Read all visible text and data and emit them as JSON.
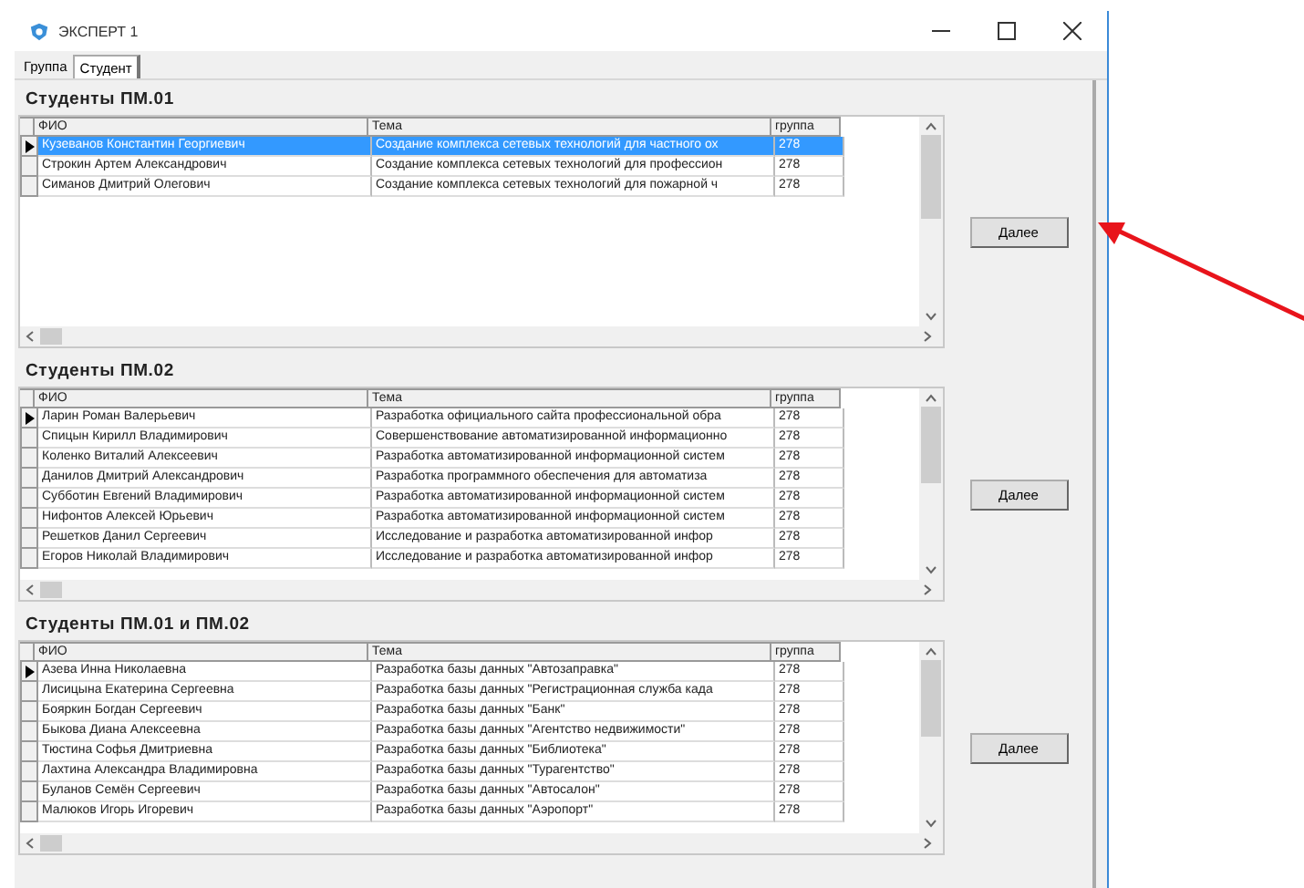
{
  "window": {
    "title": "ЭКСПЕРТ 1"
  },
  "tabs": [
    {
      "label": "Группа",
      "selected": false
    },
    {
      "label": "Студент",
      "selected": true
    }
  ],
  "sections": [
    {
      "title": "Студенты  ПМ.01",
      "button": "Далее",
      "columns": [
        "ФИО",
        "Тема",
        "группа"
      ],
      "rows": [
        {
          "cells": [
            "Кузеванов Константин Георгиевич",
            "Создание комплекса сетевых технологий для частного ох",
            "278"
          ],
          "current": true,
          "selected": true
        },
        {
          "cells": [
            "Строкин Артем Александрович",
            "Создание комплекса сетевых технологий для профессион",
            "278"
          ],
          "current": false,
          "selected": false
        },
        {
          "cells": [
            "Симанов  Дмитрий  Олегович",
            "Создание комплекса сетевых технологий для пожарной ч",
            "278"
          ],
          "current": false,
          "selected": false
        }
      ]
    },
    {
      "title": "Студенты  ПМ.02",
      "button": "Далее",
      "columns": [
        "ФИО",
        "Тема",
        "группа"
      ],
      "rows": [
        {
          "cells": [
            "Ларин Роман Валерьевич",
            "Разработка  официального сайта профессиональной обра",
            "278"
          ],
          "current": true,
          "selected": false
        },
        {
          "cells": [
            "Спицын  Кирилл  Владимирович",
            "Совершенствование автоматизированной информационно",
            "278"
          ],
          "current": false,
          "selected": false
        },
        {
          "cells": [
            "Коленко  Виталий  Алексеевич",
            "Разработка автоматизированной информационной систем",
            "278"
          ],
          "current": false,
          "selected": false
        },
        {
          "cells": [
            "Данилов  Дмитрий  Александрович",
            "Разработка программного обеспечения для автоматиза",
            "278"
          ],
          "current": false,
          "selected": false
        },
        {
          "cells": [
            "Субботин  Евгений  Владимирович",
            "Разработка автоматизированной информационной систем",
            "278"
          ],
          "current": false,
          "selected": false
        },
        {
          "cells": [
            "Нифонтов  Алексей  Юрьевич",
            "Разработка автоматизированной информационной систем",
            "278"
          ],
          "current": false,
          "selected": false
        },
        {
          "cells": [
            "Решетков  Данил  Сергеевич",
            "Исследование и разработка автоматизированной инфор",
            "278"
          ],
          "current": false,
          "selected": false
        },
        {
          "cells": [
            "Егоров  Николай  Владимирович",
            "Исследование и разработка автоматизированной инфор",
            "278"
          ],
          "current": false,
          "selected": false
        }
      ]
    },
    {
      "title": "Студенты  ПМ.01 и ПМ.02",
      "button": "Далее",
      "columns": [
        "ФИО",
        "Тема",
        "группа"
      ],
      "rows": [
        {
          "cells": [
            "Азева Инна Николаевна",
            "Разработка базы данных \"Автозаправка\"",
            "278"
          ],
          "current": true,
          "selected": false
        },
        {
          "cells": [
            "Лисицына  Екатерина  Сергеевна",
            "Разработка базы данных \"Регистрационная служба када",
            "278"
          ],
          "current": false,
          "selected": false
        },
        {
          "cells": [
            "Бояркин  Богдан  Сергеевич",
            "Разработка базы данных \"Банк\"",
            "278"
          ],
          "current": false,
          "selected": false
        },
        {
          "cells": [
            "Быкова  Диана  Алексеевна",
            "Разработка базы данных \"Агентство недвижимости\"",
            "278"
          ],
          "current": false,
          "selected": false
        },
        {
          "cells": [
            "Тюстина  Софья  Дмитриевна",
            "Разработка базы данных \"Библиотека\"",
            "278"
          ],
          "current": false,
          "selected": false
        },
        {
          "cells": [
            "Лахтина  Александра  Владимировна",
            "Разработка базы данных \"Турагентство\"",
            "278"
          ],
          "current": false,
          "selected": false
        },
        {
          "cells": [
            "Буланов  Семён  Сергеевич",
            "Разработка базы данных \"Автосалон\"",
            "278"
          ],
          "current": false,
          "selected": false
        },
        {
          "cells": [
            "Малюков  Игорь  Игоревич",
            "Разработка базы данных \"Аэропорт\"",
            "278"
          ],
          "current": false,
          "selected": false
        }
      ]
    }
  ]
}
